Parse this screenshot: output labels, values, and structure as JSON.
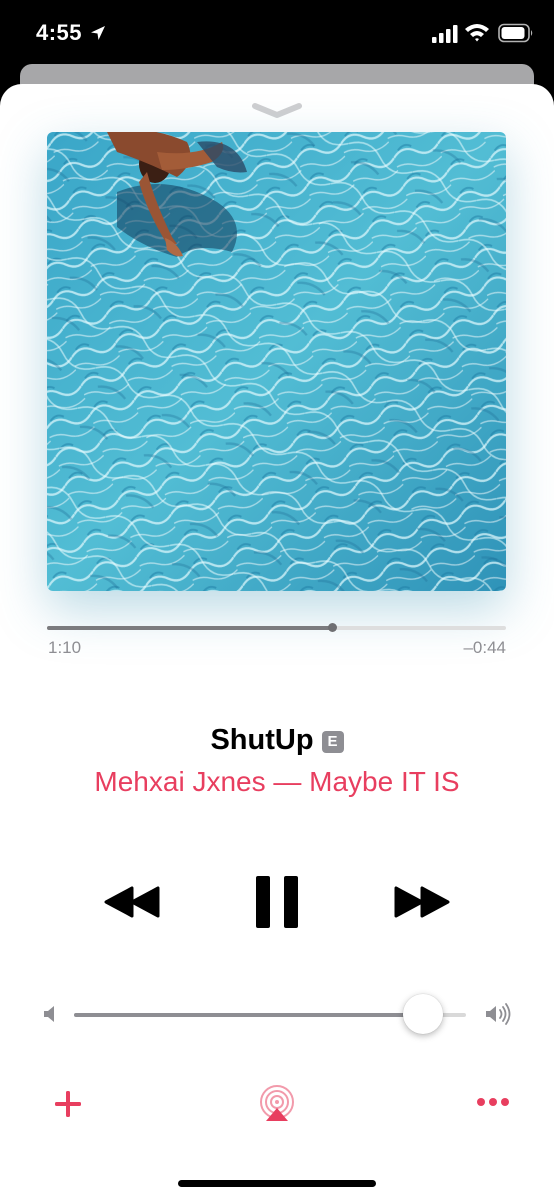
{
  "status_bar": {
    "time": "4:55",
    "icons": [
      "location-icon",
      "signal-icon",
      "wifi-icon",
      "battery-icon"
    ]
  },
  "now_playing": {
    "title": "ShutUp",
    "explicit_badge": "E",
    "subtitle": "Mehxai Jxnes — Maybe IT IS",
    "elapsed": "1:10",
    "remaining": "–0:44",
    "progress_fraction": 0.62,
    "volume_fraction": 0.89
  },
  "controls": {
    "dismiss": "chevron-down-icon",
    "rewind": "rewind-icon",
    "pause": "pause-icon",
    "forward": "fast-forward-icon",
    "volume_min": "speaker-low-icon",
    "volume_max": "speaker-high-icon",
    "add": "plus-icon",
    "airplay": "airplay-audio-icon",
    "more": "ellipsis-icon"
  },
  "colors": {
    "accent": "#e83e5f",
    "secondary_text": "#8e8e93",
    "artwork_water": "#3fb0cc"
  }
}
